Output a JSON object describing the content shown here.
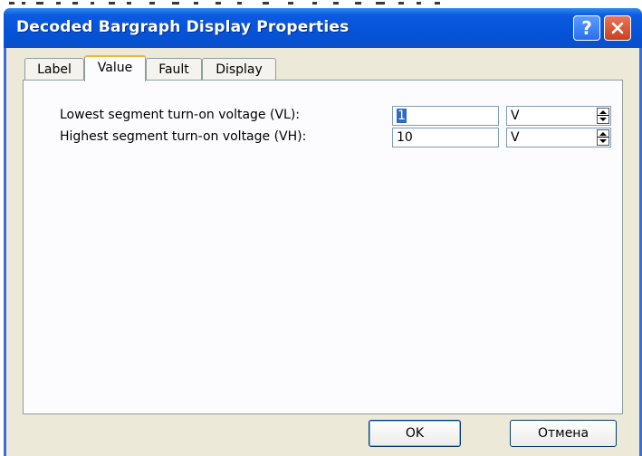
{
  "window": {
    "title": "Decoded Bargraph Display Properties",
    "help_label": "?"
  },
  "tabs": [
    {
      "label": "Label",
      "active": false
    },
    {
      "label": "Value",
      "active": true
    },
    {
      "label": "Fault",
      "active": false
    },
    {
      "label": "Display",
      "active": false
    }
  ],
  "fields": [
    {
      "label": "Lowest segment turn-on voltage (VL):",
      "value": "1",
      "unit": "V"
    },
    {
      "label": "Highest segment turn-on voltage (VH):",
      "value": "10",
      "unit": "V"
    }
  ],
  "buttons": {
    "ok": "OK",
    "cancel": "Отмена"
  },
  "colors": {
    "titlebar": "#0553d8",
    "client": "#ece9d8",
    "active_tab_highlight": "#f0b63a",
    "close_button": "#c9401e"
  }
}
